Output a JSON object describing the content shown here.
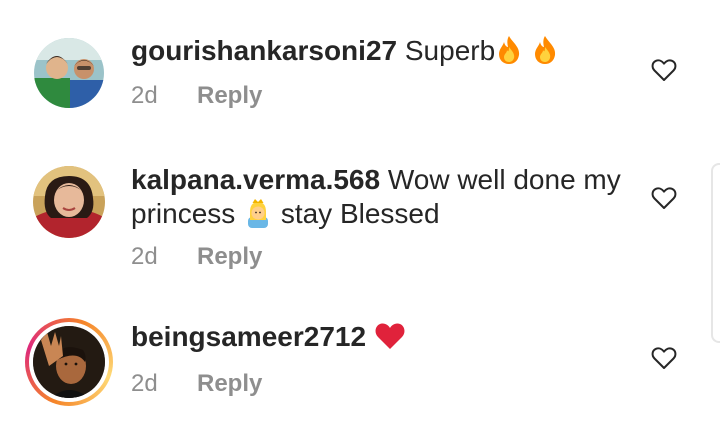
{
  "comments": [
    {
      "username": "gourishankarsoni27",
      "text": "Superb",
      "emojis": [
        "fire-icon",
        "fire-icon"
      ],
      "time": "2d",
      "reply_label": "Reply"
    },
    {
      "username": "kalpana.verma.568",
      "text_line1": "Wow well done my",
      "text_line2_before": "princess",
      "text_line2_after": "stay Blessed",
      "emojis": [
        "princess-emoji-icon"
      ],
      "time": "2d",
      "reply_label": "Reply"
    },
    {
      "username": "beingsameer2712",
      "text": "",
      "emojis": [
        "red-heart-icon"
      ],
      "time": "2d",
      "reply_label": "Reply"
    }
  ],
  "colors": {
    "text": "#262626",
    "meta": "#8e8e8e",
    "heart": "#e0223b",
    "fire": "#ff8a00",
    "story_ring_start": "#f58529",
    "story_ring_end": "#dd2a7b"
  }
}
